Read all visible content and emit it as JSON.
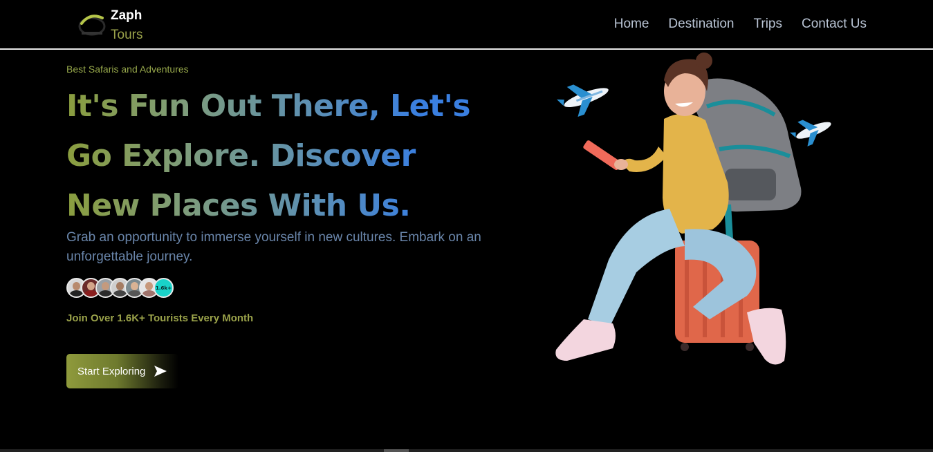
{
  "brand": {
    "name_line1": "Zaph",
    "name_line2": "Tours",
    "colors": {
      "accent": "#9aa24a",
      "blue": "#3a7fe0"
    }
  },
  "nav": {
    "items": [
      {
        "label": "Home"
      },
      {
        "label": "Destination"
      },
      {
        "label": "Trips"
      },
      {
        "label": "Contact Us"
      }
    ]
  },
  "hero": {
    "tagline": "Best Safaris and Adventures",
    "headline_line1": "It's Fun Out There, Let's",
    "headline_line2": "Go Explore. Discover",
    "headline_line3": "New Places With Us.",
    "subtext": "Grab an opportunity to immerse yourself in new cultures. Embark on an unforgettable journey.",
    "avatar_count_badge": "1.6k+",
    "join_text": "Join Over 1.6K+ Tourists Every Month",
    "cta_label": "Start Exploring",
    "cta_icon": "send-arrow-icon"
  }
}
